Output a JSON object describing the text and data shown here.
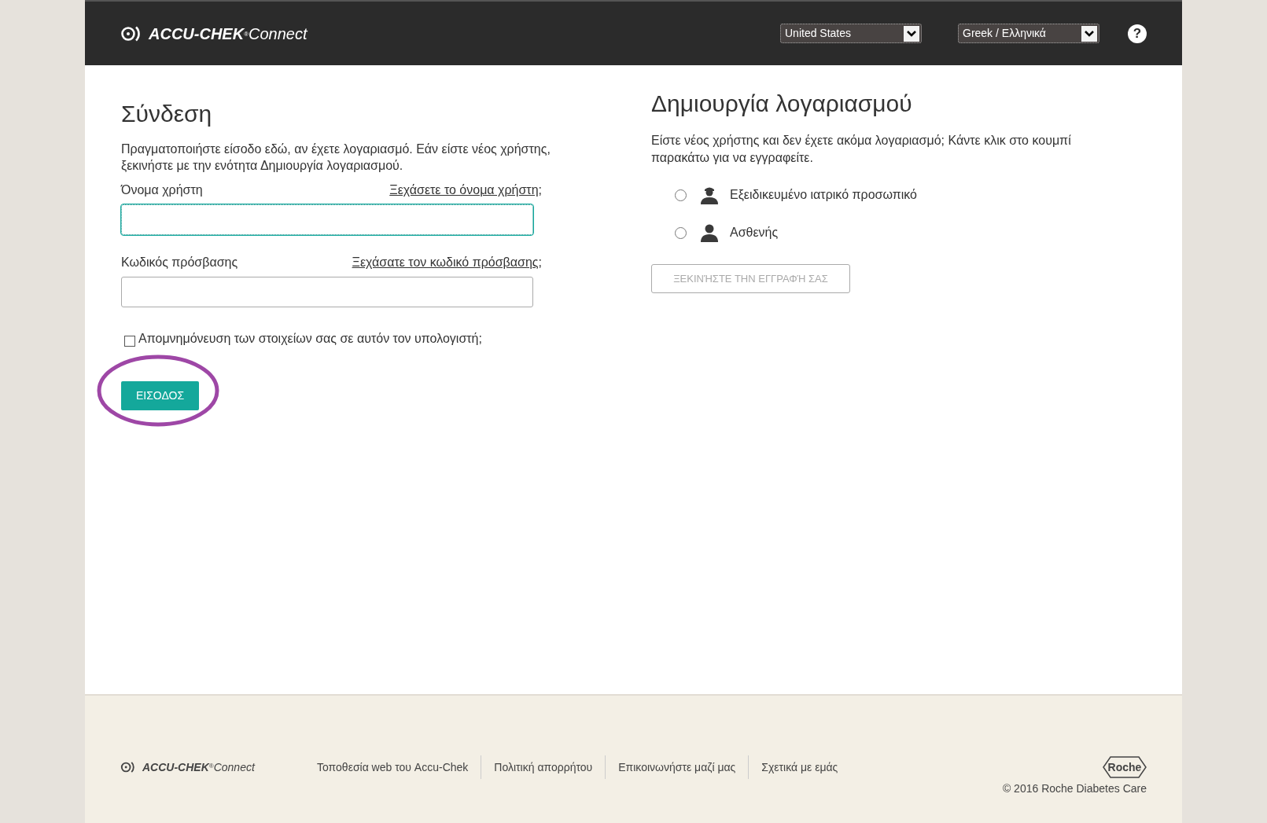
{
  "header": {
    "logo": {
      "brand": "ACCU-CHEK",
      "mark": "®",
      "product": "Connect"
    },
    "country_select": {
      "value": "United States"
    },
    "language_select": {
      "value": "Greek / Ελληνικά"
    },
    "help": "?"
  },
  "login": {
    "title": "Σύνδεση",
    "intro": "Πραγματοποιήστε είσοδο εδώ, αν έχετε λογαριασμό. Εάν είστε νέος χρήστης, ξεκινήστε με την ενότητα Δημιουργία λογαριασμού.",
    "fields": [
      {
        "label": "Όνομα χρήστη",
        "link": "Ξεχάσετε το όνομα χρήστη;",
        "focused": true
      },
      {
        "label": "Κωδικός πρόσβασης",
        "link": "Ξεχάσατε τον κωδικό πρόσβασης;",
        "focused": false
      }
    ],
    "remember": {
      "label": "Απομνημόνευση των στοιχείων σας σε αυτόν τον υπολογιστή;",
      "checked": false
    },
    "submit": "ΕΙΣΟΔΟΣ",
    "highlighted": true
  },
  "register": {
    "title": "Δημιουργία λογαριασμού",
    "intro": "Είστε νέος χρήστης και δεν έχετε ακόμα λογαριασμό; Κάντε κλικ στο κουμπί παρακάτω για να εγγραφείτε.",
    "roles": [
      {
        "label": "Εξειδικευμένο ιατρικό προσωπικό",
        "kind": "professional",
        "selected": false
      },
      {
        "label": "Ασθενής",
        "kind": "patient",
        "selected": false
      }
    ],
    "button": {
      "label": "ΞΕΚΙΝΉΣΤΕ ΤΗΝ ΕΓΓΡΑΦΉ ΣΑΣ",
      "disabled": true
    }
  },
  "footer": {
    "logo": {
      "brand": "ACCU-CHEK",
      "mark": "®",
      "product": "Connect"
    },
    "links": [
      "Τοποθεσία web του Accu-Chek",
      "Πολιτική απορρήτου",
      "Επικοινωνήστε μαζί μας",
      "Σχετικά με εμάς"
    ],
    "company_logo": "Roche",
    "copyright": "© 2016 Roche Diabetes Care"
  }
}
